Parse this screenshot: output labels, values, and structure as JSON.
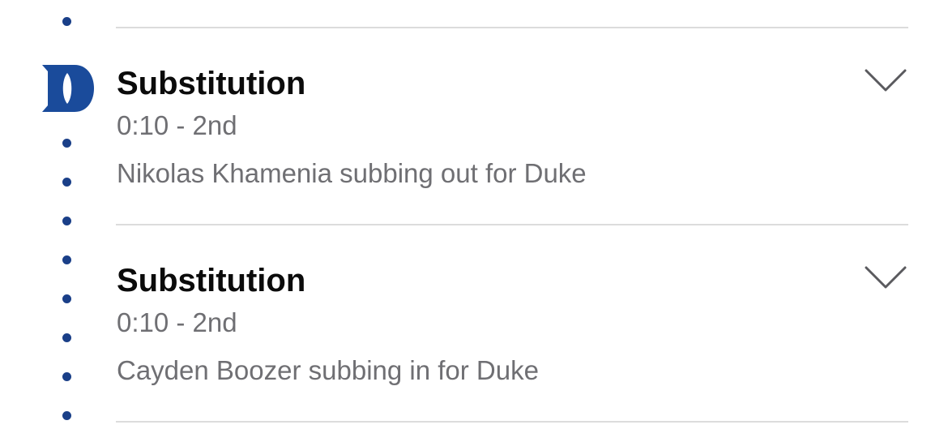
{
  "team": {
    "name": "Duke",
    "logo_icon": "duke-d-logo-icon",
    "logo_color": "#1a4b9b"
  },
  "plays": [
    {
      "title": "Substitution",
      "time": "0:10 - 2nd",
      "description": "Nikolas Khamenia subbing out for Duke",
      "expand_icon": "chevron-down-icon"
    },
    {
      "title": "Substitution",
      "time": "0:10 - 2nd",
      "description": "Cayden Boozer subbing in for Duke",
      "expand_icon": "chevron-down-icon"
    }
  ],
  "colors": {
    "timeline_dot": "#1a3f88",
    "divider": "#dcdcdc",
    "title_text": "#0b0b0b",
    "secondary_text": "#6f6f73"
  }
}
